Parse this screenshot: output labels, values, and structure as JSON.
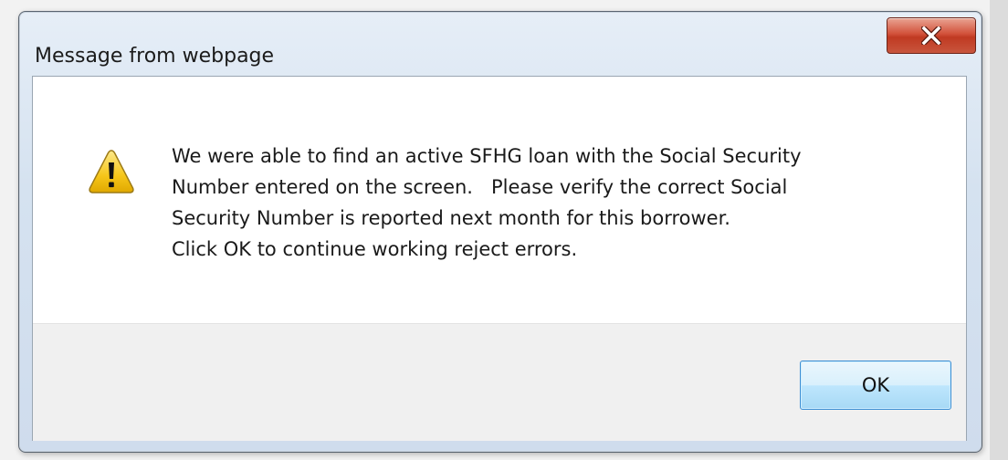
{
  "dialog": {
    "title": "Message from webpage",
    "close_icon": "close-icon",
    "warning_icon": "warning-triangle-icon",
    "message_lines": [
      "We were able to find an active SFHG loan with the Social Security",
      "Number entered on the screen.   Please verify the correct Social",
      "Security Number is reported next month for this borrower.",
      "Click OK to continue working reject errors."
    ],
    "ok_label": "OK"
  },
  "colors": {
    "frame": "#d5e2f0",
    "close_button": "#c8553d",
    "ok_button_border": "#3c8ed3",
    "warning_yellow": "#f6c619"
  }
}
